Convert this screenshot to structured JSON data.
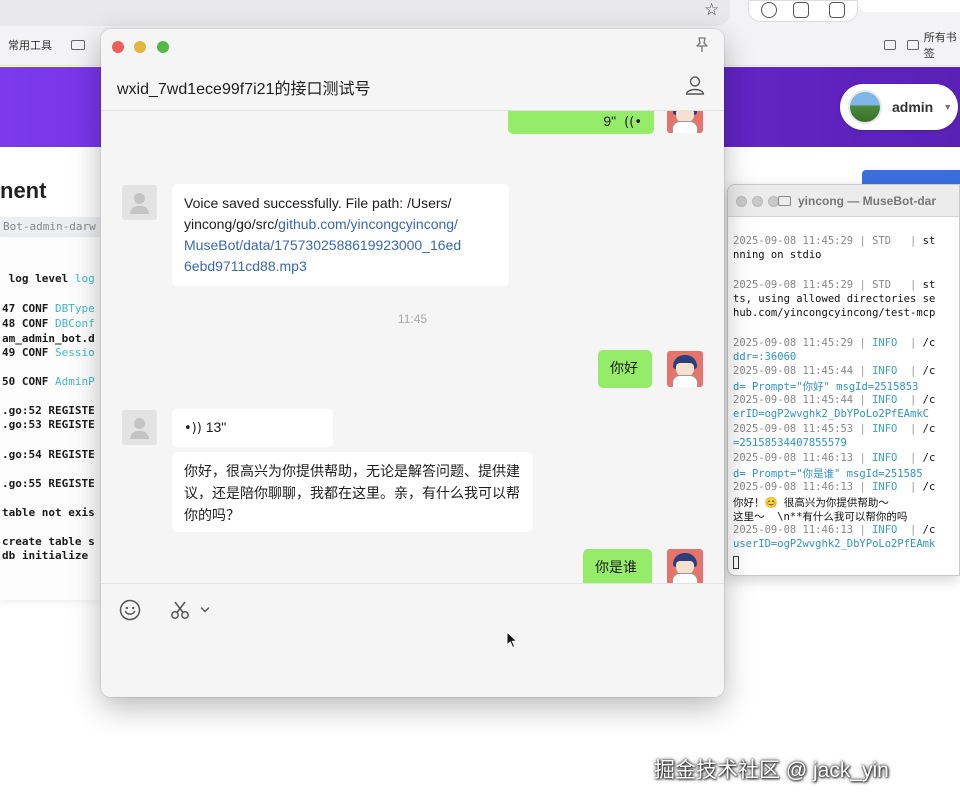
{
  "browser": {
    "bookmarks": [
      {
        "label": "常用工具"
      },
      {
        "label": "所有书签"
      }
    ]
  },
  "admin_panel": {
    "user_name": "admin",
    "page_heading": "nent",
    "tab_label": "Bot-admin-darw",
    "log_lines": [
      {
        "text": " log level ",
        "cyan": "log"
      },
      {
        "text": "47 CONF ",
        "cyan": "DBType"
      },
      {
        "text": "48 CONF ",
        "cyan": "DBConf"
      },
      {
        "text": "am_admin_bot.d",
        "cyan": ""
      },
      {
        "text": "49 CONF ",
        "cyan": "Sessio"
      },
      {
        "text": "50 CONF ",
        "cyan": "AdminP"
      },
      {
        "text": ".go:52 REGISTE",
        "cyan": ""
      },
      {
        "text": ".go:53 REGISTE",
        "cyan": ""
      },
      {
        "text": ".go:54 REGISTE",
        "cyan": ""
      },
      {
        "text": ".go:55 REGISTE",
        "cyan": ""
      },
      {
        "text": "table not exis",
        "cyan": ""
      },
      {
        "text": "create table s",
        "cyan": ""
      },
      {
        "text": "db initialize",
        "cyan": ""
      }
    ]
  },
  "terminal": {
    "title": "yincong — MuseBot-dar",
    "lines": [
      {
        "ts": "2025-09-08 11:45:29",
        "level": "STD",
        "rest": " st"
      },
      {
        "text": "nning on stdio"
      },
      {
        "ts": "2025-09-08 11:45:29",
        "level": "STD",
        "rest": " st"
      },
      {
        "text": "ts, using allowed directories se"
      },
      {
        "text": "hub.com/yincongcyincong/test-mcp"
      },
      {
        "ts": "2025-09-08 11:45:29",
        "level": "INFO",
        "rest": " /c"
      },
      {
        "text": "ddr=:36060",
        "hl": true
      },
      {
        "ts": "2025-09-08 11:45:44",
        "level": "INFO",
        "rest": " /c"
      },
      {
        "text": "d= Prompt=\"你好\" msgId=2515853",
        "hl": true
      },
      {
        "ts": "2025-09-08 11:45:44",
        "level": "INFO",
        "rest": " /c"
      },
      {
        "text": "erID=ogP2wvghk2_DbYPoLo2PfEAmkC",
        "hl": true
      },
      {
        "ts": "2025-09-08 11:45:53",
        "level": "INFO",
        "rest": " /c"
      },
      {
        "text": "=25158534407855579",
        "hl": true
      },
      {
        "ts": "2025-09-08 11:46:13",
        "level": "INFO",
        "rest": " /c"
      },
      {
        "text": "d= Prompt=\"你是谁\" msgId=251585",
        "hl": true
      },
      {
        "ts": "2025-09-08 11:46:13",
        "level": "INFO",
        "rest": " /c"
      },
      {
        "text": "你好！😊 很高兴为你提供帮助～"
      },
      {
        "text": "这里～  \\n**有什么我可以帮你的吗"
      },
      {
        "ts": "2025-09-08 11:46:13",
        "level": "INFO",
        "rest": " /c"
      },
      {
        "text": "userID=ogP2wvghk2_DbYPoLo2PfEAmk",
        "hl": true
      }
    ]
  },
  "chat": {
    "title": "wxid_7wd1ece99f7i21的接口测试号",
    "messages": {
      "top_voice": "9\"",
      "voice_saved_prefix": "Voice saved successfully. File path: /Users/",
      "voice_saved_mid": "yincong/go/src/",
      "voice_saved_link1": "github.com/yincongcyincong/",
      "voice_saved_link2": "MuseBot/data/1757302588619923000_16ed",
      "voice_saved_link3": "6ebd9711cd88.mp3",
      "time_sep": "11:45",
      "hello": "你好",
      "voice_reply": "13\"",
      "bot_reply": "你好，很高兴为你提供帮助，无论是解答问题、提供建议，还是陪你聊聊，我都在这里。亲，有什么我可以帮你的吗？",
      "who": "你是谁"
    }
  },
  "watermark": "掘金技术社区 @ jack_yin"
}
